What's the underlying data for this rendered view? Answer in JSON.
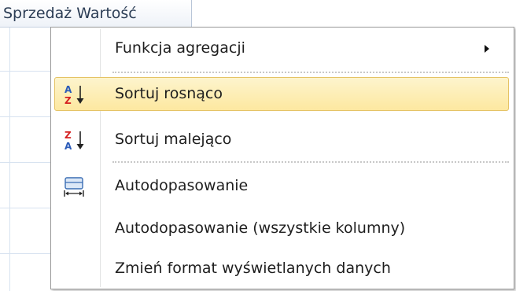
{
  "grid": {
    "column_header": "Sprzedaż Wartość"
  },
  "context_menu": {
    "items": [
      {
        "label": "Funkcja agregacji",
        "icon": "submenu-arrow-icon",
        "has_submenu": true
      },
      {
        "label": "Sortuj rosnąco",
        "icon": "sort-ascending-az-icon",
        "hovered": true
      },
      {
        "label": "Sortuj malejąco",
        "icon": "sort-descending-za-icon"
      },
      {
        "label": "Autodopasowanie",
        "icon": "autofit-column-icon"
      },
      {
        "label": "Autodopasowanie (wszystkie kolumny)"
      },
      {
        "label": "Zmień format wyświetlanych danych"
      }
    ]
  },
  "colors": {
    "hover_background_top": "#fdf4cd",
    "hover_background_bottom": "#fde8a0",
    "hover_border": "#e5c365",
    "sort_letter_red": "#d42020",
    "sort_letter_blue": "#2a5ab8",
    "grid_lines": "#d7e2f0"
  }
}
